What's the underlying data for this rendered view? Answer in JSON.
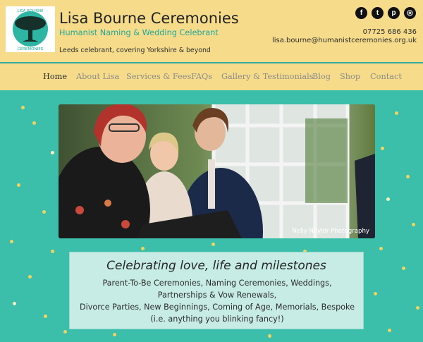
{
  "header": {
    "logo_text_top": "LISA BOURNE",
    "logo_text_bottom": "CEREMONIES",
    "title": "Lisa Bourne Ceremonies",
    "tagline": "Humanist Naming & Wedding Celebrant",
    "subline": "Leeds celebrant, covering Yorkshire & beyond",
    "phone": "07725 686 436",
    "email": "lisa.bourne@humanistceremonies.org.uk",
    "social": [
      {
        "icon": "facebook-icon",
        "glyph": "f"
      },
      {
        "icon": "twitter-icon",
        "glyph": "t"
      },
      {
        "icon": "pinterest-icon",
        "glyph": "p"
      },
      {
        "icon": "instagram-icon",
        "glyph": "◎"
      }
    ]
  },
  "nav": {
    "items": [
      "Home",
      "About Lisa",
      "Services & Fees",
      "FAQs",
      "Gallery & Testimonials",
      "Blog",
      "Shop",
      "Contact"
    ],
    "active": "Home"
  },
  "hero": {
    "credit": "Nelly Naylor Photography"
  },
  "intro": {
    "title": "Celebrating love, life and milestones",
    "lines": [
      "Parent-To-Be Ceremonies, Naming Ceremonies, Weddings,",
      "Partnerships & Vow Renewals,",
      "Divorce Parties, New Beginnings, Coming of Age, Memorials, Bespoke",
      "(i.e. anything you blinking fancy!)"
    ]
  },
  "colors": {
    "header_bg": "#f6dc8a",
    "page_bg": "#3cbfaa",
    "accent": "#1ea99b",
    "confetti": "#f2d35f"
  }
}
